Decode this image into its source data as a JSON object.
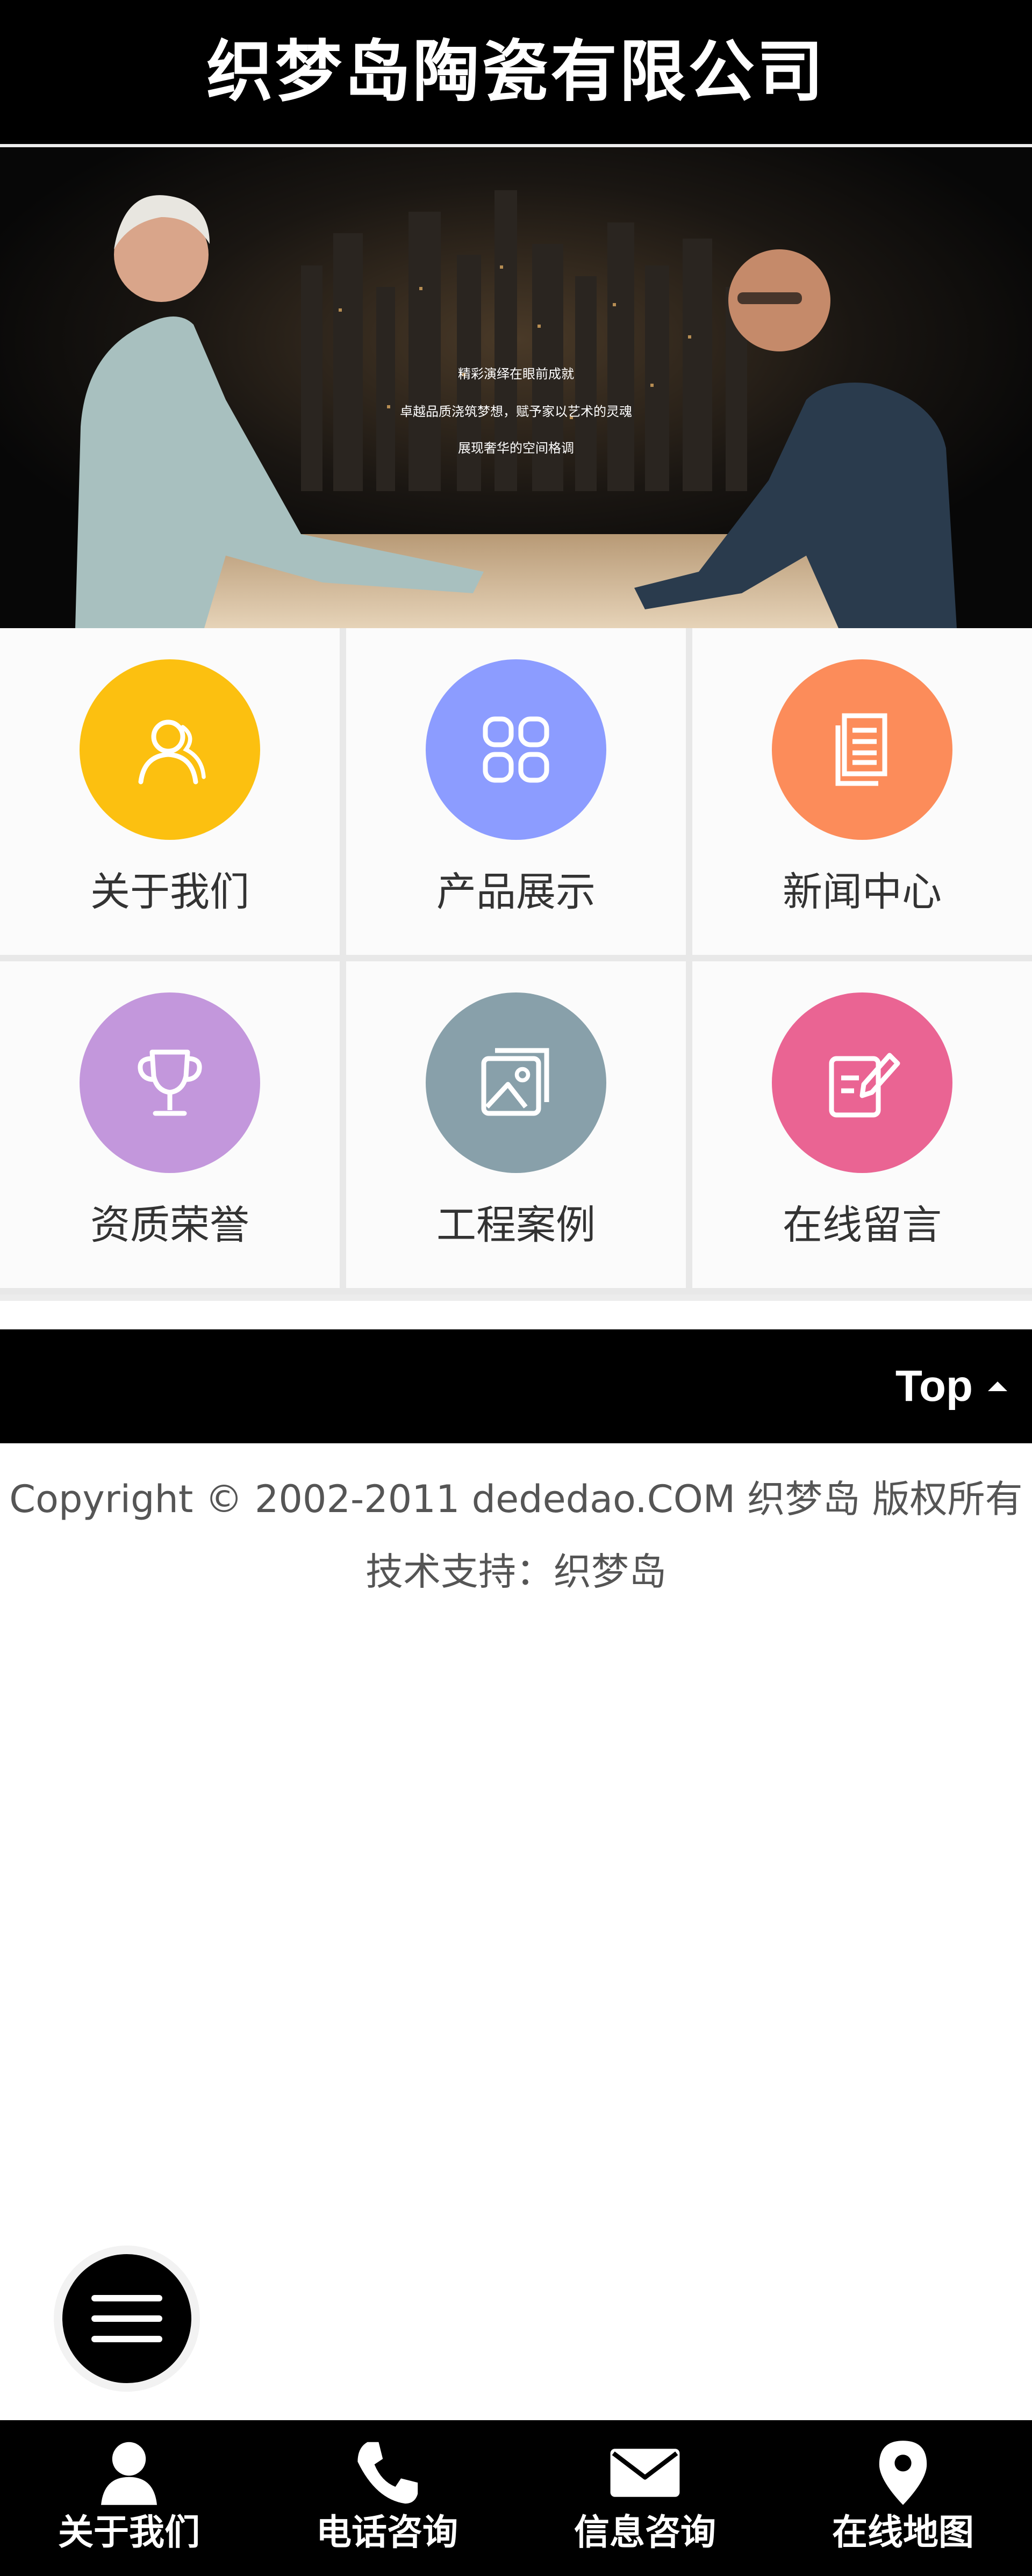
{
  "header": {
    "title": "织梦岛陶瓷有限公司"
  },
  "banner": {
    "lines": [
      "精彩演绎在眼前成就",
      "卓越品质浇筑梦想，赋予家以艺术的灵魂",
      "展现奢华的空间格调"
    ]
  },
  "grid": {
    "items": [
      {
        "label": "关于我们",
        "icon": "user-icon",
        "color": "#fcc010"
      },
      {
        "label": "产品展示",
        "icon": "grid-icon",
        "color": "#8c9cff"
      },
      {
        "label": "新闻中心",
        "icon": "document-icon",
        "color": "#fc8c5a"
      },
      {
        "label": "资质荣誉",
        "icon": "trophy-icon",
        "color": "#c397dc"
      },
      {
        "label": "工程案例",
        "icon": "image-icon",
        "color": "#88a0aa"
      },
      {
        "label": "在线留言",
        "icon": "edit-note-icon",
        "color": "#ea6493"
      }
    ]
  },
  "topbar": {
    "label": "Top"
  },
  "footer": {
    "copyright": "Copyright © 2002-2011 dededao.COM 织梦岛 版权所有",
    "support": "技术支持：织梦岛"
  },
  "bottom_nav": {
    "items": [
      {
        "label": "关于我们",
        "icon": "user-icon"
      },
      {
        "label": "电话咨询",
        "icon": "phone-icon"
      },
      {
        "label": "信息咨询",
        "icon": "mail-icon"
      },
      {
        "label": "在线地图",
        "icon": "map-pin-icon"
      }
    ]
  }
}
